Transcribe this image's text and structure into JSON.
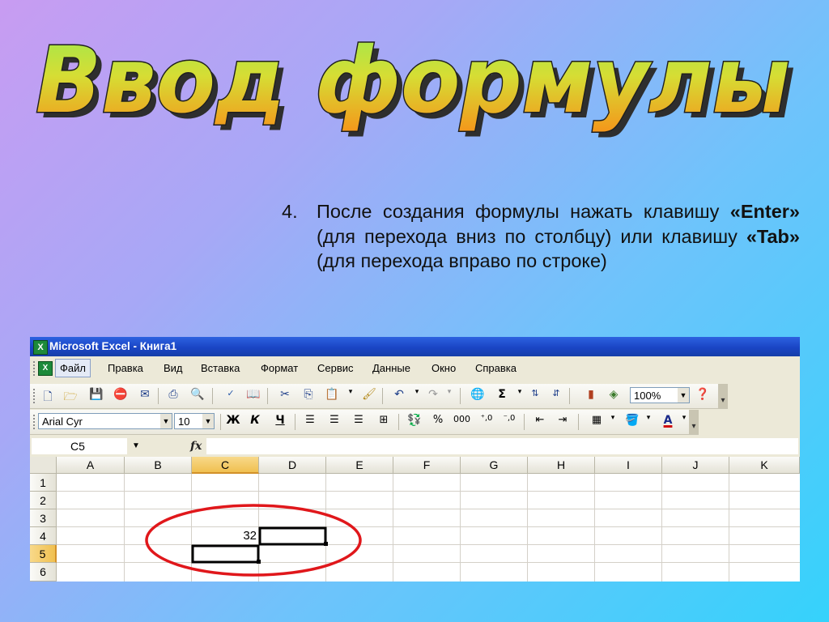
{
  "slide": {
    "title": "Ввод формулы",
    "step_number": "4.",
    "instruction": {
      "part1": "После создания формулы нажать клавишу ",
      "enter_key": "«Enter»",
      "part2": " (для перехода вниз по столбцу) или клавишу ",
      "tab_key": "«Tab»",
      "part3": " (для перехода вправо по строке)"
    }
  },
  "excel": {
    "title": "Microsoft Excel - Книга1",
    "logo_text": "X",
    "menu": [
      "Файл",
      "Правка",
      "Вид",
      "Вставка",
      "Формат",
      "Сервис",
      "Данные",
      "Окно",
      "Справка"
    ],
    "toolbar_standard": {
      "icons": [
        "new-document-icon",
        "open-folder-icon",
        "save-icon",
        "permission-icon",
        "email-icon",
        "print-icon",
        "print-preview-icon",
        "spelling-icon",
        "research-icon",
        "cut-icon",
        "copy-icon",
        "paste-icon",
        "format-painter-icon",
        "undo-icon",
        "redo-icon",
        "hyperlink-icon",
        "autosum-icon",
        "sort-ascending-icon",
        "sort-descending-icon",
        "chart-wizard-icon",
        "drawing-icon",
        "help-icon"
      ],
      "zoom": "100%"
    },
    "toolbar_formatting": {
      "font_name": "Arial Cyr",
      "font_size": "10",
      "bold": "Ж",
      "italic": "К",
      "underline": "Ч",
      "percent": "%",
      "thousands": "000"
    },
    "name_box": "C5",
    "fx_label": "fx",
    "formula_value": "",
    "columns": [
      "A",
      "B",
      "C",
      "D",
      "E",
      "F",
      "G",
      "H",
      "I",
      "J",
      "K"
    ],
    "rows": [
      "1",
      "2",
      "3",
      "4",
      "5",
      "6"
    ],
    "selected_column": "C",
    "selected_row": "5",
    "cells": {
      "C4": "32"
    },
    "colors": {
      "annotation_ellipse": "#e0171b",
      "title_fill_top": "#8de04a",
      "title_fill_bottom": "#f2a31a"
    }
  }
}
